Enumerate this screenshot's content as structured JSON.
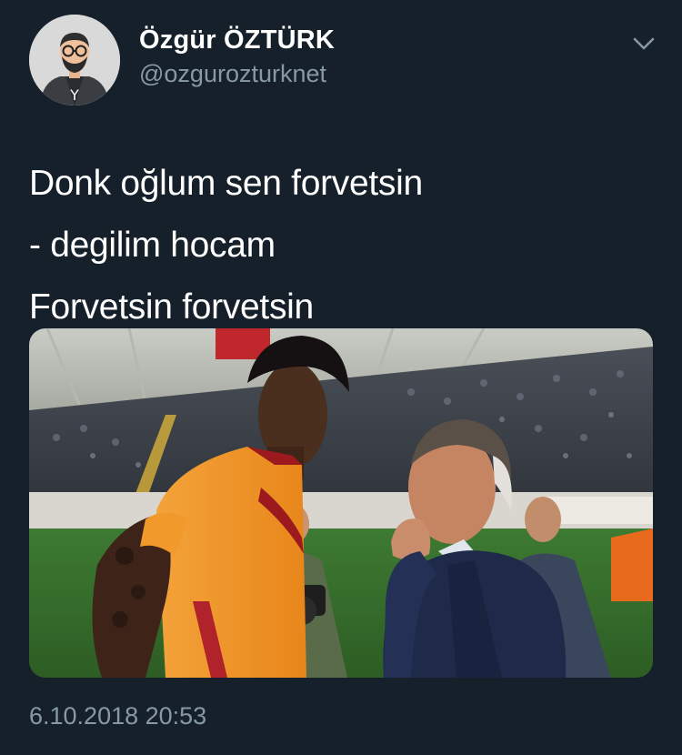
{
  "tweet": {
    "author": {
      "display_name": "Özgür ÖZTÜRK",
      "handle": "@ozgurozturknet",
      "avatar_icon": "avatar-illustration-icon"
    },
    "menu_icon": "chevron-down-icon",
    "text_lines": [
      "Donk oğlum sen forvetsin",
      "- degilim hocam",
      "Forvetsin forvetsin"
    ],
    "photo": {
      "description_icon": "photo-coach-and-player",
      "jersey_colors": [
        "#f39a1f",
        "#9c1a1e"
      ]
    },
    "timestamp": "6.10.2018 20:53"
  },
  "colors": {
    "background": "#15202b",
    "primary_text": "#ffffff",
    "secondary_text": "#8899a6"
  }
}
